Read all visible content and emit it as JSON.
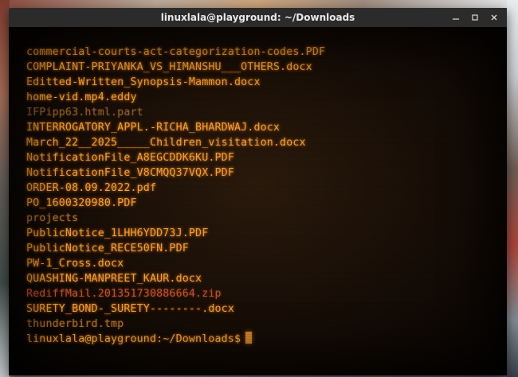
{
  "window": {
    "title": "linuxlala@playground: ~/Downloads",
    "controls": {
      "minimize_icon": "minimize-icon",
      "maximize_icon": "maximize-icon",
      "close_icon": "close-icon"
    }
  },
  "terminal": {
    "theme": {
      "foreground": "#f6a23a",
      "dim": "#8c5f33",
      "archive": "#c2542e",
      "background": "#1a0f07"
    },
    "listing": [
      {
        "name": "commercial-courts-act-categorization-codes.PDF",
        "style": "normal"
      },
      {
        "name": "COMPLAINT-PRIYANKA_VS_HIMANSHU___OTHERS.docx",
        "style": "normal"
      },
      {
        "name": "Editted-Written_Synopsis-Mammon.docx",
        "style": "normal"
      },
      {
        "name": "home-vid.mp4.eddy",
        "style": "normal"
      },
      {
        "name": "IFPipp63.html.part",
        "style": "dim"
      },
      {
        "name": "INTERROGATORY_APPL.-RICHA_BHARDWAJ.docx",
        "style": "normal"
      },
      {
        "name": "March_22__2025_____Children_visitation.docx",
        "style": "normal"
      },
      {
        "name": "NotificationFile_A8EGCDDK6KU.PDF",
        "style": "normal"
      },
      {
        "name": "NotificationFile_V8CMQQ37VQX.PDF",
        "style": "normal"
      },
      {
        "name": "ORDER-08.09.2022.pdf",
        "style": "normal"
      },
      {
        "name": "PO_1600320980.PDF",
        "style": "normal"
      },
      {
        "name": "projects",
        "style": "mid"
      },
      {
        "name": "PublicNotice_1LHH6YDD73J.PDF",
        "style": "normal"
      },
      {
        "name": "PublicNotice_RECE50FN.PDF",
        "style": "normal"
      },
      {
        "name": "PW-1_Cross.docx",
        "style": "normal"
      },
      {
        "name": "QUASHING-MANPREET_KAUR.docx",
        "style": "normal"
      },
      {
        "name": "RediffMail.201351730886664.zip",
        "style": "zip"
      },
      {
        "name": "SURETY_BOND-_SURETY--------.docx",
        "style": "normal"
      },
      {
        "name": "thunderbird.tmp",
        "style": "mid"
      }
    ],
    "prompt": "linuxlala@playground:~/Downloads$"
  }
}
